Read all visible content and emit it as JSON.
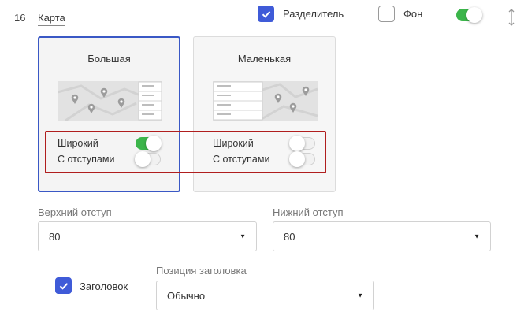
{
  "block": {
    "number": "16",
    "name": "Карта"
  },
  "header": {
    "divider": {
      "label": "Разделитель",
      "checked": true
    },
    "background": {
      "label": "Фон",
      "checked": false
    },
    "visibility_toggle": {
      "on": true
    }
  },
  "layout_cards": [
    {
      "title": "Большая",
      "selected": true,
      "options": [
        {
          "label": "Широкий",
          "on": true
        },
        {
          "label": "С отступами",
          "on": false
        }
      ]
    },
    {
      "title": "Маленькая",
      "selected": false,
      "options": [
        {
          "label": "Широкий",
          "on": false
        },
        {
          "label": "С отступами",
          "on": false
        }
      ]
    }
  ],
  "padding": {
    "top": {
      "label": "Верхний отступ",
      "value": "80"
    },
    "bottom": {
      "label": "Нижний отступ",
      "value": "80"
    }
  },
  "heading": {
    "checkbox": {
      "label": "Заголовок",
      "checked": true
    },
    "position": {
      "label": "Позиция заголовка",
      "value": "Обычно"
    }
  },
  "colors": {
    "accent": "#3f5bd8",
    "toggle_on": "#3bb54a",
    "highlight": "#b01e1e"
  }
}
